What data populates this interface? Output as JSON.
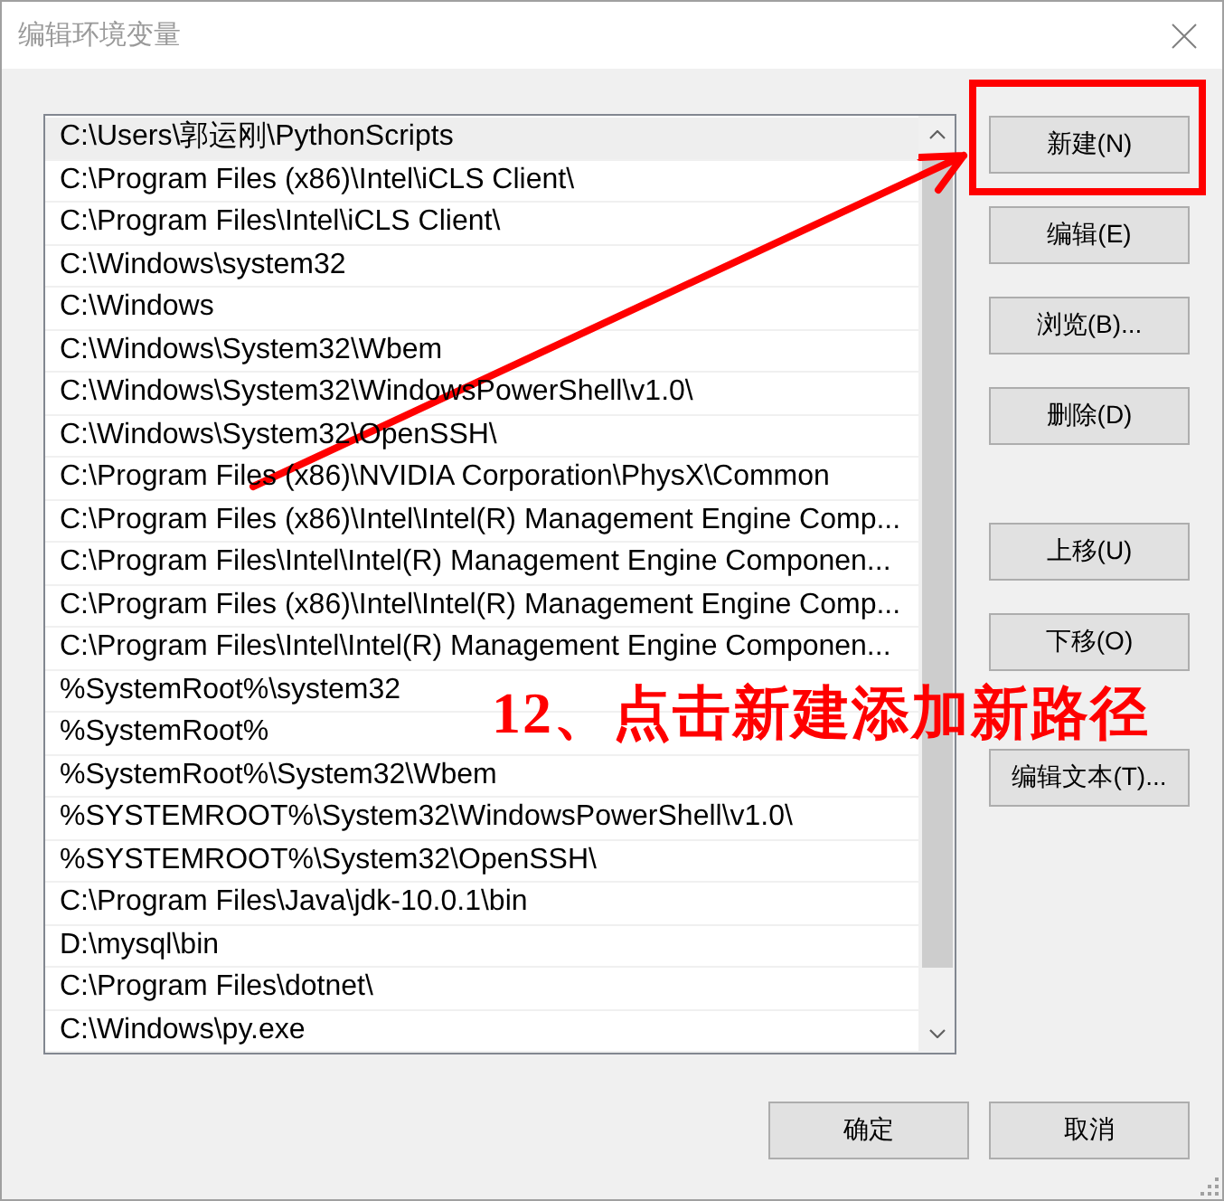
{
  "window": {
    "title": "编辑环境变量"
  },
  "path_list": {
    "items": [
      {
        "text": "C:\\Users\\郭运刚\\PythonScripts",
        "selected": true
      },
      {
        "text": "C:\\Program Files (x86)\\Intel\\iCLS Client\\",
        "selected": false
      },
      {
        "text": "C:\\Program Files\\Intel\\iCLS Client\\",
        "selected": false
      },
      {
        "text": "C:\\Windows\\system32",
        "selected": false
      },
      {
        "text": "C:\\Windows",
        "selected": false
      },
      {
        "text": "C:\\Windows\\System32\\Wbem",
        "selected": false
      },
      {
        "text": "C:\\Windows\\System32\\WindowsPowerShell\\v1.0\\",
        "selected": false
      },
      {
        "text": "C:\\Windows\\System32\\OpenSSH\\",
        "selected": false
      },
      {
        "text": "C:\\Program Files (x86)\\NVIDIA Corporation\\PhysX\\Common",
        "selected": false
      },
      {
        "text": "C:\\Program Files (x86)\\Intel\\Intel(R) Management Engine Comp...",
        "selected": false
      },
      {
        "text": "C:\\Program Files\\Intel\\Intel(R) Management Engine Componen...",
        "selected": false
      },
      {
        "text": "C:\\Program Files (x86)\\Intel\\Intel(R) Management Engine Comp...",
        "selected": false
      },
      {
        "text": "C:\\Program Files\\Intel\\Intel(R) Management Engine Componen...",
        "selected": false
      },
      {
        "text": "%SystemRoot%\\system32",
        "selected": false
      },
      {
        "text": "%SystemRoot%",
        "selected": false
      },
      {
        "text": "%SystemRoot%\\System32\\Wbem",
        "selected": false
      },
      {
        "text": "%SYSTEMROOT%\\System32\\WindowsPowerShell\\v1.0\\",
        "selected": false
      },
      {
        "text": "%SYSTEMROOT%\\System32\\OpenSSH\\",
        "selected": false
      },
      {
        "text": "C:\\Program Files\\Java\\jdk-10.0.1\\bin",
        "selected": false
      },
      {
        "text": "D:\\mysql\\bin",
        "selected": false
      },
      {
        "text": "C:\\Program Files\\dotnet\\",
        "selected": false
      },
      {
        "text": "C:\\Windows\\py.exe",
        "selected": false
      }
    ]
  },
  "side_buttons": {
    "groups": [
      {
        "buttons": [
          {
            "label": "新建(N)",
            "highlighted": true
          },
          {
            "label": "编辑(E)",
            "highlighted": false
          },
          {
            "label": "浏览(B)...",
            "highlighted": false
          },
          {
            "label": "删除(D)",
            "highlighted": false
          }
        ]
      },
      {
        "buttons": [
          {
            "label": "上移(U)",
            "highlighted": false
          },
          {
            "label": "下移(O)",
            "highlighted": false
          }
        ]
      },
      {
        "buttons": [
          {
            "label": "编辑文本(T)...",
            "highlighted": false
          }
        ]
      }
    ]
  },
  "dialog_buttons": [
    {
      "label": "确定"
    },
    {
      "label": "取消"
    }
  ],
  "annotation": {
    "text": "12、点击新建添加新路径"
  }
}
